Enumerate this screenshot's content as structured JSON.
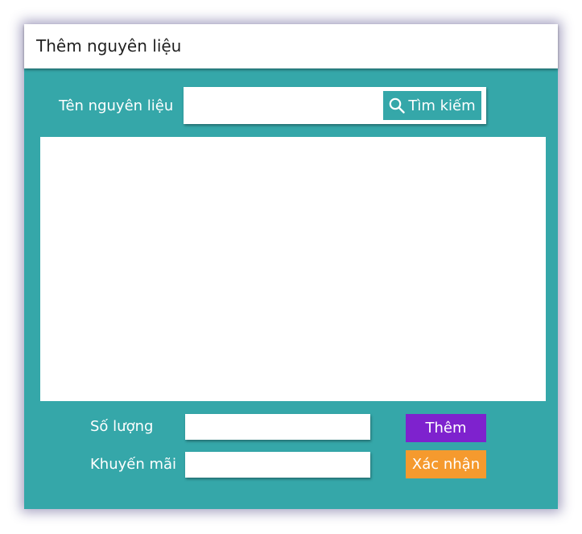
{
  "window": {
    "title": "Thêm nguyên liệu"
  },
  "search": {
    "label": "Tên nguyên liệu",
    "value": "",
    "button_label": "Tìm kiếm",
    "button_icon": "search-icon"
  },
  "results": {
    "items": []
  },
  "form": {
    "quantity_label": "Số lượng",
    "quantity_value": "",
    "discount_label": "Khuyến mãi",
    "discount_value": ""
  },
  "buttons": {
    "add_label": "Thêm",
    "confirm_label": "Xác nhận"
  },
  "colors": {
    "background": "#35a7a9",
    "add_button": "#7e22ce",
    "confirm_button": "#f59a2e",
    "search_button": "#35a7a9"
  }
}
